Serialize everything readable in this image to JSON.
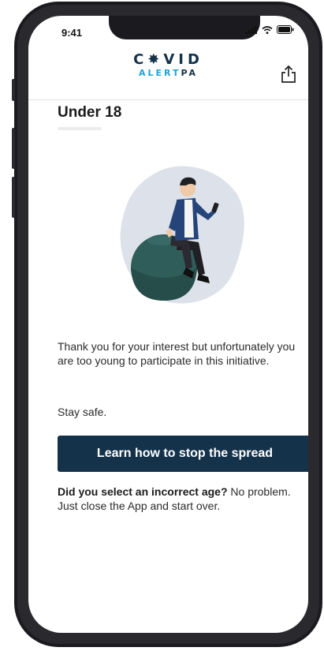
{
  "status_bar": {
    "time": "9:41"
  },
  "header": {
    "logo_line1": "C✸VID",
    "logo_alert": "ALERT",
    "logo_pa": "PA",
    "share_icon": "share-icon"
  },
  "page": {
    "title": "Under 18",
    "message": "Thank you for your interest but unfortunately you are too young to participate in this initiative.",
    "stay_safe": "Stay safe.",
    "cta_label": "Learn how to stop the spread",
    "note_bold": "Did you select an incorrect age?",
    "note_rest": " No problem. Just close the App and start over."
  },
  "colors": {
    "primary": "#14324a",
    "accent": "#1da3d6",
    "blob": "#dde2ea",
    "ball": "#2f5d5a"
  }
}
